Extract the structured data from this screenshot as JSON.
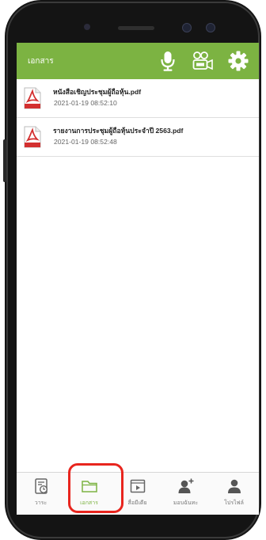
{
  "header": {
    "title": "เอกสาร",
    "icons": [
      "microphone-icon",
      "video-conference-icon",
      "settings-icon"
    ]
  },
  "documents": [
    {
      "name": "หนังสือเชิญประชุมผู้ถือหุ้น.pdf",
      "timestamp": "2021-01-19 08:52:10",
      "icon": "pdf-file-icon"
    },
    {
      "name": "รายงานการประชุมผู้ถือหุ้นประจำปี 2563.pdf",
      "timestamp": "2021-01-19 08:52:48",
      "icon": "pdf-file-icon"
    }
  ],
  "nav": {
    "items": [
      {
        "label": "วาระ",
        "icon": "agenda-icon",
        "active": false
      },
      {
        "label": "เอกสาร",
        "icon": "folder-icon",
        "active": true
      },
      {
        "label": "สื่อมีเดีย",
        "icon": "media-player-icon",
        "active": false
      },
      {
        "label": "มอบฉันทะ",
        "icon": "add-proxy-icon",
        "active": false
      },
      {
        "label": "โปรไฟล์",
        "icon": "profile-icon",
        "active": false
      }
    ]
  },
  "colors": {
    "accent": "#7cb342",
    "highlight": "#e8251e",
    "pdf_red": "#d32f2f"
  }
}
